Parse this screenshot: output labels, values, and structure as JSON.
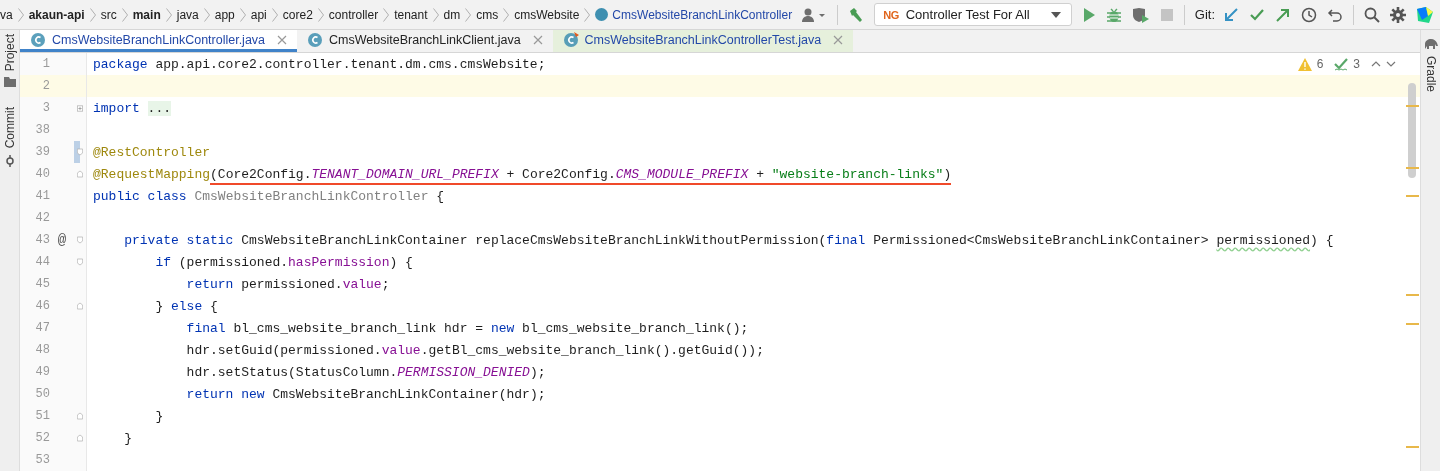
{
  "breadcrumbs": [
    {
      "label": "va",
      "bold": false,
      "kind": "folder"
    },
    {
      "label": "akaun-api",
      "bold": true,
      "kind": "folder"
    },
    {
      "label": "src",
      "bold": false,
      "kind": "folder"
    },
    {
      "label": "main",
      "bold": true,
      "kind": "folder"
    },
    {
      "label": "java",
      "bold": false,
      "kind": "folder"
    },
    {
      "label": "app",
      "bold": false,
      "kind": "folder"
    },
    {
      "label": "api",
      "bold": false,
      "kind": "folder"
    },
    {
      "label": "core2",
      "bold": false,
      "kind": "folder"
    },
    {
      "label": "controller",
      "bold": false,
      "kind": "folder"
    },
    {
      "label": "tenant",
      "bold": false,
      "kind": "folder"
    },
    {
      "label": "dm",
      "bold": false,
      "kind": "folder"
    },
    {
      "label": "cms",
      "bold": false,
      "kind": "folder"
    },
    {
      "label": "cmsWebsite",
      "bold": false,
      "kind": "folder"
    },
    {
      "label": "CmsWebsiteBranchLinkController",
      "bold": false,
      "kind": "class"
    }
  ],
  "run_config": {
    "icon_text": "NG",
    "label": "Controller Test For All"
  },
  "git_label": "Git:",
  "tabs": [
    {
      "label": "CmsWebsiteBranchLinkController.java",
      "selected": true,
      "kind": "class"
    },
    {
      "label": "CmsWebsiteBranchLinkClient.java",
      "selected": false,
      "kind": "class"
    },
    {
      "label": "CmsWebsiteBranchLinkControllerTest.java",
      "selected": false,
      "kind": "test"
    }
  ],
  "left_tools": [
    {
      "label": "Project",
      "kind": "folder"
    },
    {
      "label": "Commit",
      "kind": "commit"
    }
  ],
  "right_tools": [
    {
      "label": "Gradle"
    }
  ],
  "inspections": {
    "warnings": "6",
    "weak_warnings": "3"
  },
  "lines": [
    {
      "num": "1",
      "current": false,
      "changed": false,
      "tokens": [
        {
          "kind": "kw",
          "t": "package"
        },
        {
          "kind": "p",
          "t": " app.api.core2.controller.tenant.dm.cms.cmsWebsite;"
        }
      ]
    },
    {
      "num": "2",
      "current": true,
      "changed": false
    },
    {
      "num": "3",
      "current": false,
      "changed": false,
      "collapsed": true,
      "tokens": [
        {
          "kind": "kw",
          "t": "import "
        },
        {
          "kind": "folded",
          "t": "..."
        }
      ]
    },
    {
      "num": "38",
      "current": false,
      "changed": false
    },
    {
      "num": "39",
      "current": false,
      "changed": true,
      "fold_open": true,
      "tokens": [
        {
          "kind": "ann",
          "t": "@RestController"
        }
      ]
    },
    {
      "num": "40",
      "current": false,
      "changed": false,
      "fold_close": true,
      "underlined": true,
      "tokens": [
        {
          "kind": "ann",
          "t": "@RequestMapping"
        },
        {
          "kind": "p",
          "t": "(Core2Config."
        },
        {
          "kind": "static",
          "t": "TENANT_DOMAIN_URL_PREFIX"
        },
        {
          "kind": "p",
          "t": " + Core2Config."
        },
        {
          "kind": "static",
          "t": "CMS_MODULE_PREFIX"
        },
        {
          "kind": "p",
          "t": " + "
        },
        {
          "kind": "str",
          "t": "\"website-branch-links\""
        },
        {
          "kind": "p",
          "t": ")"
        }
      ]
    },
    {
      "num": "41",
      "current": false,
      "changed": false,
      "tokens": [
        {
          "kind": "kw",
          "t": "public class "
        },
        {
          "kind": "unused",
          "t": "CmsWebsiteBranchLinkController"
        },
        {
          "kind": "p",
          "t": " {"
        }
      ]
    },
    {
      "num": "42",
      "current": false,
      "changed": false
    },
    {
      "num": "43",
      "current": false,
      "changed": false,
      "fold_open": true,
      "mark": "@",
      "tokens": [
        {
          "kind": "kw",
          "t": "    private static"
        },
        {
          "kind": "p",
          "t": " CmsWebsiteBranchLinkContainer replaceCmsWebsiteBranchLinkWithoutPermission("
        },
        {
          "kind": "kw",
          "t": "final"
        },
        {
          "kind": "p",
          "t": " Permissioned<CmsWebsiteBranchLinkContainer> "
        },
        {
          "kind": "typo",
          "t": "permissioned"
        },
        {
          "kind": "p",
          "t": ") {"
        }
      ]
    },
    {
      "num": "44",
      "current": false,
      "changed": false,
      "fold_open": true,
      "tokens": [
        {
          "kind": "kw",
          "t": "        if"
        },
        {
          "kind": "p",
          "t": " (permissioned."
        },
        {
          "kind": "field",
          "t": "hasPermission"
        },
        {
          "kind": "p",
          "t": ") {"
        }
      ]
    },
    {
      "num": "45",
      "current": false,
      "changed": false,
      "tokens": [
        {
          "kind": "kw",
          "t": "            return"
        },
        {
          "kind": "p",
          "t": " permissioned."
        },
        {
          "kind": "field",
          "t": "value"
        },
        {
          "kind": "p",
          "t": ";"
        }
      ]
    },
    {
      "num": "46",
      "current": false,
      "changed": false,
      "fold_close": true,
      "tokens": [
        {
          "kind": "p",
          "t": "        } "
        },
        {
          "kind": "kw",
          "t": "else"
        },
        {
          "kind": "p",
          "t": " {"
        }
      ]
    },
    {
      "num": "47",
      "current": false,
      "changed": false,
      "tokens": [
        {
          "kind": "kw",
          "t": "            final"
        },
        {
          "kind": "p",
          "t": " bl_cms_website_branch_link hdr = "
        },
        {
          "kind": "kw",
          "t": "new"
        },
        {
          "kind": "p",
          "t": " bl_cms_website_branch_link();"
        }
      ]
    },
    {
      "num": "48",
      "current": false,
      "changed": false,
      "tokens": [
        {
          "kind": "p",
          "t": "            hdr.setGuid(permissioned."
        },
        {
          "kind": "field",
          "t": "value"
        },
        {
          "kind": "p",
          "t": ".getBl_cms_website_branch_link().getGuid());"
        }
      ]
    },
    {
      "num": "49",
      "current": false,
      "changed": false,
      "tokens": [
        {
          "kind": "p",
          "t": "            hdr.setStatus(StatusColumn."
        },
        {
          "kind": "static",
          "t": "PERMISSION_DENIED"
        },
        {
          "kind": "p",
          "t": ");"
        }
      ]
    },
    {
      "num": "50",
      "current": false,
      "changed": false,
      "tokens": [
        {
          "kind": "kw",
          "t": "            return new"
        },
        {
          "kind": "p",
          "t": " CmsWebsiteBranchLinkContainer(hdr);"
        }
      ]
    },
    {
      "num": "51",
      "current": false,
      "changed": false,
      "fold_close": true,
      "tokens": [
        {
          "kind": "p",
          "t": "        }"
        }
      ]
    },
    {
      "num": "52",
      "current": false,
      "changed": false,
      "fold_close": true,
      "tokens": [
        {
          "kind": "p",
          "t": "    }"
        }
      ]
    },
    {
      "num": "53",
      "current": false,
      "changed": false
    }
  ]
}
